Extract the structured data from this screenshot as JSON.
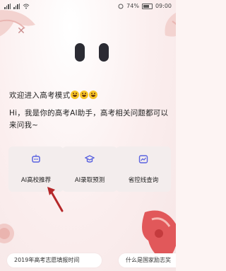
{
  "status_bar": {
    "battery": "74%",
    "time": "09:00"
  },
  "screen": {
    "welcome": "欢迎进入高考模式",
    "intro": "Hi，我是你的高考AI助手，高考相关问题都可以来问我~"
  },
  "cards": [
    {
      "label": "AI高校推荐",
      "icon": "robot-icon"
    },
    {
      "label": "AI录取预测",
      "icon": "graduation-cap-icon"
    },
    {
      "label": "省控线查询",
      "icon": "chart-icon"
    }
  ],
  "suggestions": [
    "2019年高考志愿填报时间",
    "什么是国家励志奖"
  ],
  "colors": {
    "accent": "#5b63e0",
    "background": "#fbeeee",
    "arrow": "#b5282a"
  }
}
